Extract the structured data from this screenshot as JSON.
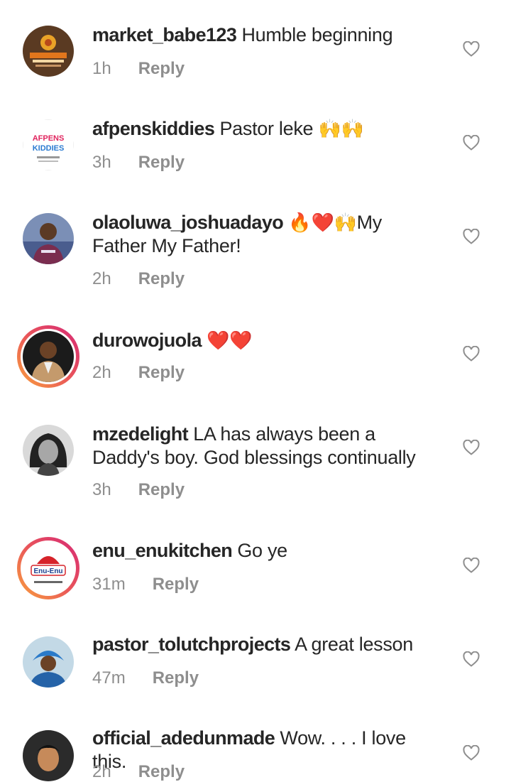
{
  "comments": [
    {
      "user": "market_babe123",
      "text": "Humble beginning",
      "emoji": "",
      "time": "1h",
      "reply": "Reply"
    },
    {
      "user": "afpenskiddies",
      "text": "Pastor  leke",
      "emoji": "🙌🙌",
      "time": "3h",
      "reply": "Reply",
      "avatar_text": "AFPENS KIDDIES"
    },
    {
      "user": "olaoluwa_joshuadayo",
      "text": "My Father My Father!",
      "emoji": "🔥❤️🙌",
      "time": "2h",
      "reply": "Reply"
    },
    {
      "user": "durowojuola",
      "text": "",
      "emoji": "❤️❤️",
      "time": "2h",
      "reply": "Reply"
    },
    {
      "user": "mzedelight",
      "text": "LA has always been a Daddy's boy. God blessings continually",
      "emoji": "",
      "time": "3h",
      "reply": "Reply"
    },
    {
      "user": "enu_enukitchen",
      "text": "Go ye",
      "emoji": "",
      "time": "31m",
      "reply": "Reply",
      "avatar_text": "Enu-Enu"
    },
    {
      "user": "pastor_tolutchprojects",
      "text": "A great lesson",
      "emoji": "",
      "time": "47m",
      "reply": "Reply"
    },
    {
      "user": "official_adedunmade",
      "text": "Wow. . . . I love this.",
      "emoji": "",
      "time": "2h",
      "reply": "Reply"
    }
  ],
  "colors": {
    "text": "#262626",
    "meta": "#8e8e8e",
    "story_ring": "#e9555a",
    "heart_outline": "#8e8e8e"
  },
  "icons": {
    "like": "heart-outline-icon"
  }
}
